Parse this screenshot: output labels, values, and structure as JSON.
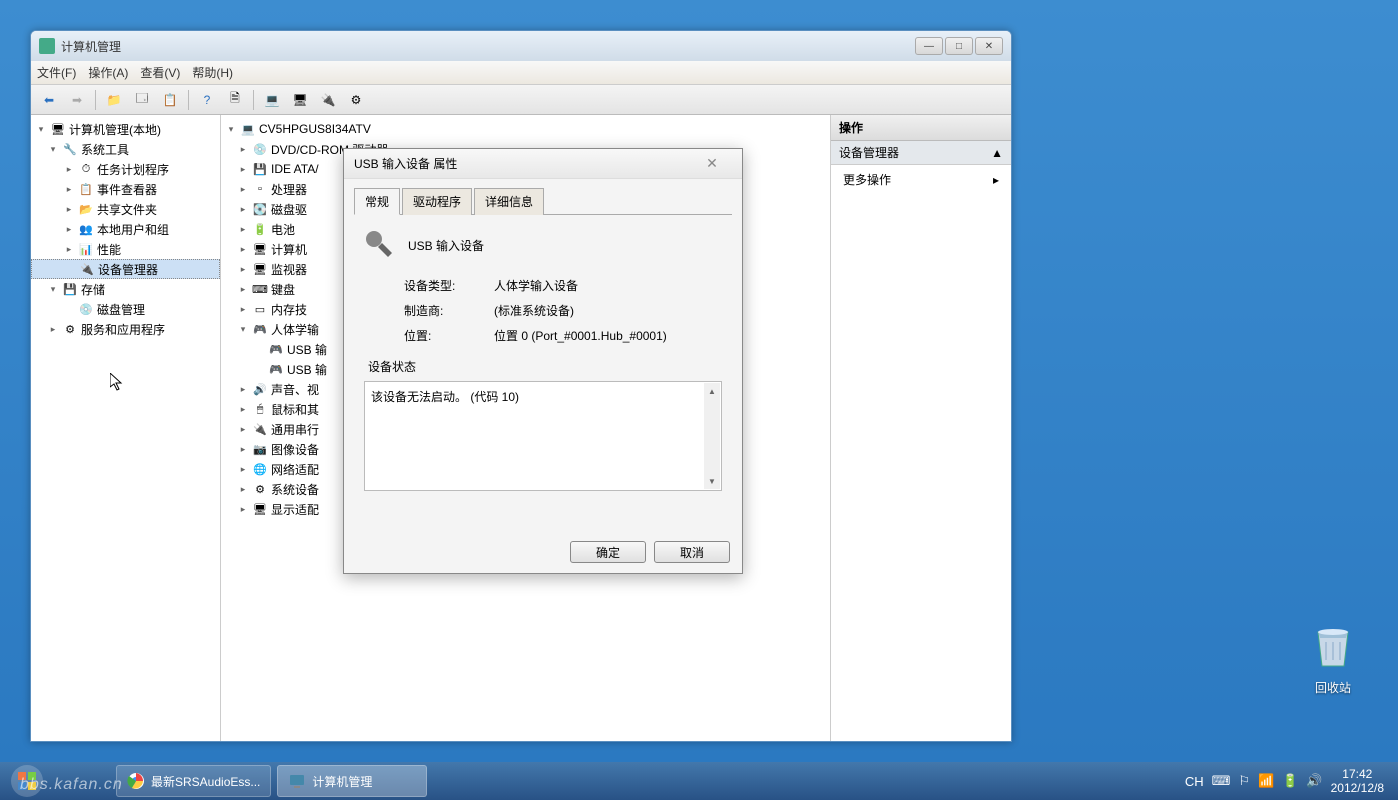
{
  "window": {
    "title": "计算机管理",
    "menu": {
      "file": "文件(F)",
      "action": "操作(A)",
      "view": "查看(V)",
      "help": "帮助(H)"
    }
  },
  "left_tree": {
    "root": "计算机管理(本地)",
    "system_tools": "系统工具",
    "task_scheduler": "任务计划程序",
    "event_viewer": "事件查看器",
    "shared_folders": "共享文件夹",
    "local_users": "本地用户和组",
    "performance": "性能",
    "device_manager": "设备管理器",
    "storage": "存储",
    "disk_mgmt": "磁盘管理",
    "services": "服务和应用程序"
  },
  "mid_tree": {
    "computer": "CV5HPGUS8I34ATV",
    "dvd": "DVD/CD-ROM 驱动器",
    "ide": "IDE ATA/",
    "cpu": "处理器",
    "disk": "磁盘驱",
    "battery": "电池",
    "pc": "计算机",
    "monitor": "监视器",
    "keyboard": "键盘",
    "memory": "内存技",
    "hid": "人体学输",
    "usb1": "USB 输",
    "usb2": "USB 输",
    "sound": "声音、视",
    "mouse": "鼠标和其",
    "usb_ctrl": "通用串行",
    "imaging": "图像设备",
    "network": "网络适配",
    "system": "系统设备",
    "display": "显示适配"
  },
  "right_pane": {
    "header": "操作",
    "sub": "设备管理器",
    "more": "更多操作"
  },
  "dialog": {
    "title": "USB 输入设备 属性",
    "tabs": {
      "general": "常规",
      "driver": "驱动程序",
      "details": "详细信息"
    },
    "device_name": "USB 输入设备",
    "type_label": "设备类型:",
    "type_value": "人体学输入设备",
    "mfr_label": "制造商:",
    "mfr_value": "(标准系统设备)",
    "loc_label": "位置:",
    "loc_value": "位置 0 (Port_#0001.Hub_#0001)",
    "status_label": "设备状态",
    "status_text": "该设备无法启动。 (代码 10)",
    "ok": "确定",
    "cancel": "取消"
  },
  "desktop": {
    "recycle": "回收站"
  },
  "taskbar": {
    "task1": "最新SRSAudioEss...",
    "task2": "计算机管理",
    "lang": "CH",
    "time": "17:42",
    "date": "2012/12/8"
  },
  "watermark": "bbs.kafan.cn"
}
